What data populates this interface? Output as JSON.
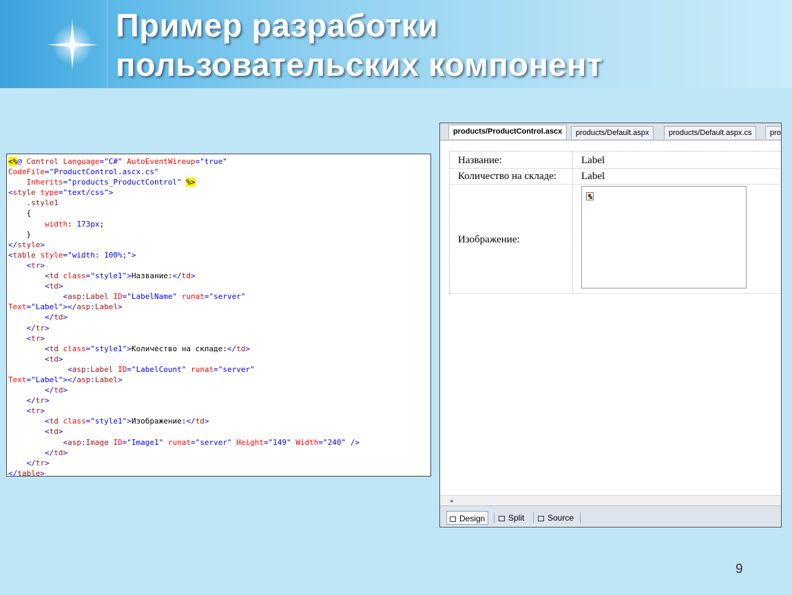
{
  "slide": {
    "title_line1": "Пример разработки",
    "title_line2": "пользовательских компонент",
    "page_number": "9"
  },
  "code_lines": [
    [
      {
        "t": "<%",
        "c": "hl"
      },
      {
        "t": "@ ",
        "c": "p"
      },
      {
        "t": "Control ",
        "c": "k"
      },
      {
        "t": "Language",
        "c": "a"
      },
      {
        "t": "=",
        "c": "p"
      },
      {
        "t": "\"C#\"",
        "c": "v"
      },
      {
        "t": " AutoEventWireup",
        "c": "a"
      },
      {
        "t": "=",
        "c": "p"
      },
      {
        "t": "\"true\"",
        "c": "v"
      }
    ],
    [
      {
        "t": "CodeFile",
        "c": "a"
      },
      {
        "t": "=",
        "c": "p"
      },
      {
        "t": "\"ProductControl.ascx.cs\"",
        "c": "v"
      }
    ],
    [
      {
        "t": "    Inherits",
        "c": "a"
      },
      {
        "t": "=",
        "c": "p"
      },
      {
        "t": "\"products_ProductControl\"",
        "c": "v"
      },
      {
        "t": " ",
        "c": ""
      },
      {
        "t": "%>",
        "c": "hl"
      }
    ],
    [
      {
        "t": "<",
        "c": "p"
      },
      {
        "t": "style ",
        "c": "k"
      },
      {
        "t": "type",
        "c": "a"
      },
      {
        "t": "=",
        "c": "p"
      },
      {
        "t": "\"text/css\"",
        "c": "v"
      },
      {
        "t": ">",
        "c": "p"
      }
    ],
    [
      {
        "t": "    .style1",
        "c": "k"
      }
    ],
    [
      {
        "t": "    {",
        "c": ""
      }
    ],
    [
      {
        "t": "        width",
        "c": "a"
      },
      {
        "t": ": ",
        "c": ""
      },
      {
        "t": "173px",
        "c": "v"
      },
      {
        "t": ";",
        "c": ""
      }
    ],
    [
      {
        "t": "    }",
        "c": ""
      }
    ],
    [
      {
        "t": "</",
        "c": "p"
      },
      {
        "t": "style",
        "c": "k"
      },
      {
        "t": ">",
        "c": "p"
      }
    ],
    [
      {
        "t": "<",
        "c": "p"
      },
      {
        "t": "table ",
        "c": "k"
      },
      {
        "t": "style",
        "c": "a"
      },
      {
        "t": "=",
        "c": "p"
      },
      {
        "t": "\"width: 100%;\"",
        "c": "v"
      },
      {
        "t": ">",
        "c": "p"
      }
    ],
    [
      {
        "t": "    <",
        "c": "p"
      },
      {
        "t": "tr",
        "c": "k"
      },
      {
        "t": ">",
        "c": "p"
      }
    ],
    [
      {
        "t": "        <",
        "c": "p"
      },
      {
        "t": "td ",
        "c": "k"
      },
      {
        "t": "class",
        "c": "a"
      },
      {
        "t": "=",
        "c": "p"
      },
      {
        "t": "\"style1\"",
        "c": "v"
      },
      {
        "t": ">",
        "c": "p"
      },
      {
        "t": "Название:",
        "c": ""
      },
      {
        "t": "</",
        "c": "p"
      },
      {
        "t": "td",
        "c": "k"
      },
      {
        "t": ">",
        "c": "p"
      }
    ],
    [
      {
        "t": "        <",
        "c": "p"
      },
      {
        "t": "td",
        "c": "k"
      },
      {
        "t": ">",
        "c": "p"
      }
    ],
    [
      {
        "t": "            <",
        "c": "p"
      },
      {
        "t": "asp",
        "c": "k"
      },
      {
        "t": ":",
        "c": "p"
      },
      {
        "t": "Label ",
        "c": "k"
      },
      {
        "t": "ID",
        "c": "a"
      },
      {
        "t": "=",
        "c": "p"
      },
      {
        "t": "\"LabelName\"",
        "c": "v"
      },
      {
        "t": " runat",
        "c": "a"
      },
      {
        "t": "=",
        "c": "p"
      },
      {
        "t": "\"server\"",
        "c": "v"
      }
    ],
    [
      {
        "t": "Text",
        "c": "a"
      },
      {
        "t": "=",
        "c": "p"
      },
      {
        "t": "\"Label\"",
        "c": "v"
      },
      {
        "t": "></",
        "c": "p"
      },
      {
        "t": "asp",
        "c": "k"
      },
      {
        "t": ":",
        "c": "p"
      },
      {
        "t": "Label",
        "c": "k"
      },
      {
        "t": ">",
        "c": "p"
      }
    ],
    [
      {
        "t": "        </",
        "c": "p"
      },
      {
        "t": "td",
        "c": "k"
      },
      {
        "t": ">",
        "c": "p"
      }
    ],
    [
      {
        "t": "    </",
        "c": "p"
      },
      {
        "t": "tr",
        "c": "k"
      },
      {
        "t": ">",
        "c": "p"
      }
    ],
    [
      {
        "t": "    <",
        "c": "p"
      },
      {
        "t": "tr",
        "c": "k"
      },
      {
        "t": ">",
        "c": "p"
      }
    ],
    [
      {
        "t": "        <",
        "c": "p"
      },
      {
        "t": "td ",
        "c": "k"
      },
      {
        "t": "class",
        "c": "a"
      },
      {
        "t": "=",
        "c": "p"
      },
      {
        "t": "\"style1\"",
        "c": "v"
      },
      {
        "t": ">",
        "c": "p"
      },
      {
        "t": "Количество на складе:",
        "c": ""
      },
      {
        "t": "</",
        "c": "p"
      },
      {
        "t": "td",
        "c": "k"
      },
      {
        "t": ">",
        "c": "p"
      }
    ],
    [
      {
        "t": "        <",
        "c": "p"
      },
      {
        "t": "td",
        "c": "k"
      },
      {
        "t": ">",
        "c": "p"
      }
    ],
    [
      {
        "t": "             <",
        "c": "p"
      },
      {
        "t": "asp",
        "c": "k"
      },
      {
        "t": ":",
        "c": "p"
      },
      {
        "t": "Label ",
        "c": "k"
      },
      {
        "t": "ID",
        "c": "a"
      },
      {
        "t": "=",
        "c": "p"
      },
      {
        "t": "\"LabelCount\"",
        "c": "v"
      },
      {
        "t": " runat",
        "c": "a"
      },
      {
        "t": "=",
        "c": "p"
      },
      {
        "t": "\"server\"",
        "c": "v"
      }
    ],
    [
      {
        "t": "Text",
        "c": "a"
      },
      {
        "t": "=",
        "c": "p"
      },
      {
        "t": "\"Label\"",
        "c": "v"
      },
      {
        "t": "></",
        "c": "p"
      },
      {
        "t": "asp",
        "c": "k"
      },
      {
        "t": ":",
        "c": "p"
      },
      {
        "t": "Label",
        "c": "k"
      },
      {
        "t": ">",
        "c": "p"
      }
    ],
    [
      {
        "t": "        </",
        "c": "p"
      },
      {
        "t": "td",
        "c": "k"
      },
      {
        "t": ">",
        "c": "p"
      }
    ],
    [
      {
        "t": "    </",
        "c": "p"
      },
      {
        "t": "tr",
        "c": "k"
      },
      {
        "t": ">",
        "c": "p"
      }
    ],
    [
      {
        "t": "    <",
        "c": "p"
      },
      {
        "t": "tr",
        "c": "k"
      },
      {
        "t": ">",
        "c": "p"
      }
    ],
    [
      {
        "t": "        <",
        "c": "p"
      },
      {
        "t": "td ",
        "c": "k"
      },
      {
        "t": "class",
        "c": "a"
      },
      {
        "t": "=",
        "c": "p"
      },
      {
        "t": "\"style1\"",
        "c": "v"
      },
      {
        "t": ">",
        "c": "p"
      },
      {
        "t": "Изображение:",
        "c": ""
      },
      {
        "t": "</",
        "c": "p"
      },
      {
        "t": "td",
        "c": "k"
      },
      {
        "t": ">",
        "c": "p"
      }
    ],
    [
      {
        "t": "        <",
        "c": "p"
      },
      {
        "t": "td",
        "c": "k"
      },
      {
        "t": ">",
        "c": "p"
      }
    ],
    [
      {
        "t": "            <",
        "c": "p"
      },
      {
        "t": "asp",
        "c": "k"
      },
      {
        "t": ":",
        "c": "p"
      },
      {
        "t": "Image ",
        "c": "k"
      },
      {
        "t": "ID",
        "c": "a"
      },
      {
        "t": "=",
        "c": "p"
      },
      {
        "t": "\"Image1\"",
        "c": "v"
      },
      {
        "t": " runat",
        "c": "a"
      },
      {
        "t": "=",
        "c": "p"
      },
      {
        "t": "\"server\"",
        "c": "v"
      },
      {
        "t": " Height",
        "c": "a"
      },
      {
        "t": "=",
        "c": "p"
      },
      {
        "t": "\"149\"",
        "c": "v"
      },
      {
        "t": " Width",
        "c": "a"
      },
      {
        "t": "=",
        "c": "p"
      },
      {
        "t": "\"240\"",
        "c": "v"
      },
      {
        "t": " />",
        "c": "p"
      }
    ],
    [
      {
        "t": "        </",
        "c": "p"
      },
      {
        "t": "td",
        "c": "k"
      },
      {
        "t": ">",
        "c": "p"
      }
    ],
    [
      {
        "t": "    </",
        "c": "p"
      },
      {
        "t": "tr",
        "c": "k"
      },
      {
        "t": ">",
        "c": "p"
      }
    ],
    [
      {
        "t": "</",
        "c": "p"
      },
      {
        "t": "table",
        "c": "k"
      },
      {
        "t": ">",
        "c": "p"
      }
    ]
  ],
  "ide": {
    "tabs": [
      "products/ProductControl.ascx",
      "products/Default.aspx",
      "products/Default.aspx.cs",
      "pro"
    ],
    "design_rows": [
      {
        "label": "Название:",
        "value": "Label"
      },
      {
        "label": "Количество на складе:",
        "value": "Label"
      },
      {
        "label": "Изображение:",
        "value": ""
      }
    ],
    "scroll_arrow": "◂",
    "view_buttons": [
      "Design",
      "Split",
      "Source"
    ],
    "selected_view": "Design"
  },
  "colors": {
    "background": "#bfe6f7",
    "tag": "#a31515",
    "attribute": "#ff0000",
    "value": "#0000ff",
    "highlight": "#ffee00"
  }
}
